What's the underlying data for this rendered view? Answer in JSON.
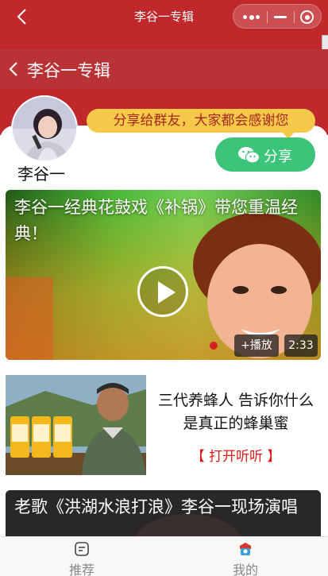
{
  "window": {
    "title": "李谷一专辑"
  },
  "header": {
    "subtitle": "李谷一专辑"
  },
  "author": {
    "name": "李谷一"
  },
  "share": {
    "bubble_text": "分享给群友，大家都会感谢您",
    "button_label": "分享"
  },
  "feed": {
    "video1": {
      "title": "李谷一经典花鼓戏《补锅》带您重温经典！",
      "add_play": "+播放",
      "duration": "2:33"
    },
    "ad": {
      "title": "三代养蜂人 告诉你什么是真正的蜂巢蜜",
      "link": "【 打开听听 】"
    },
    "video2": {
      "title": "老歌《洪湖水浪打浪》李谷一现场演唱"
    }
  },
  "tabbar": {
    "tabs": [
      {
        "label": "推荐",
        "icon": "recommend-icon"
      },
      {
        "label": "我的",
        "icon": "mine-icon"
      }
    ]
  },
  "colors": {
    "header_red": "#c0282b",
    "share_green": "#3cc47b",
    "bubble_yellow": "#f6c94a",
    "link_red": "#e01818"
  }
}
